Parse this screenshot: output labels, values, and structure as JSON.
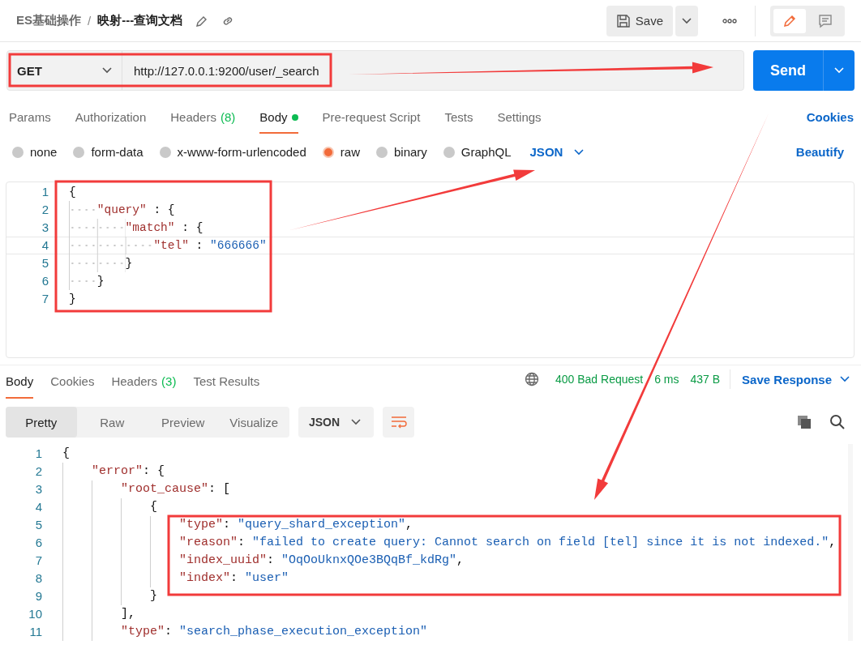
{
  "breadcrumb": {
    "collection": "ES基础操作",
    "separator": "/",
    "request": "映射---查询文档"
  },
  "save_button": "Save",
  "mode_toggle": [
    {
      "kind": "edit",
      "selected": true
    },
    {
      "kind": "comment",
      "selected": false
    }
  ],
  "request": {
    "method": "GET",
    "url": "http://127.0.0.1:9200/user/_search",
    "send": "Send"
  },
  "request_tabs": [
    {
      "label": "Params",
      "selected": false
    },
    {
      "label": "Authorization",
      "selected": false
    },
    {
      "label": "Headers",
      "count": "(8)",
      "selected": false
    },
    {
      "label": "Body",
      "has_content": true,
      "selected": true
    },
    {
      "label": "Pre-request Script",
      "selected": false
    },
    {
      "label": "Tests",
      "selected": false
    },
    {
      "label": "Settings",
      "selected": false
    }
  ],
  "cookies_link": "Cookies",
  "body_types": [
    {
      "label": "none",
      "selected": false
    },
    {
      "label": "form-data",
      "selected": false
    },
    {
      "label": "x-www-form-urlencoded",
      "selected": false
    },
    {
      "label": "raw",
      "selected": true
    },
    {
      "label": "binary",
      "selected": false
    },
    {
      "label": "GraphQL",
      "selected": false
    }
  ],
  "body_format": "JSON",
  "beautify_link": "Beautify",
  "request_body": [
    {
      "number": "1",
      "text": "{",
      "active": false
    },
    {
      "number": "2",
      "text": "    \"query\" : {",
      "active": false
    },
    {
      "number": "3",
      "text": "        \"match\" : {",
      "active": false
    },
    {
      "number": "4",
      "text": "            \"tel\" : \"666666\"",
      "active": true
    },
    {
      "number": "5",
      "text": "        }",
      "active": false
    },
    {
      "number": "6",
      "text": "    }",
      "active": false
    },
    {
      "number": "7",
      "text": "}",
      "active": false
    }
  ],
  "response_tabs": [
    {
      "label": "Body",
      "selected": true
    },
    {
      "label": "Cookies",
      "selected": false
    },
    {
      "label": "Headers",
      "count": "(3)",
      "selected": false
    },
    {
      "label": "Test Results",
      "selected": false
    }
  ],
  "status": {
    "code": "400 Bad Request",
    "time": "6 ms",
    "size": "437 B"
  },
  "save_response": "Save Response",
  "view_modes": [
    {
      "label": "Pretty",
      "selected": true
    },
    {
      "label": "Raw",
      "selected": false
    },
    {
      "label": "Preview",
      "selected": false
    },
    {
      "label": "Visualize",
      "selected": false
    }
  ],
  "response_format": "JSON",
  "response_body": [
    {
      "number": "1",
      "text": "{"
    },
    {
      "number": "2",
      "text": "    \"error\": {"
    },
    {
      "number": "3",
      "text": "        \"root_cause\": ["
    },
    {
      "number": "4",
      "text": "            {"
    },
    {
      "number": "5",
      "text": "                \"type\": \"query_shard_exception\","
    },
    {
      "number": "6",
      "text": "                \"reason\": \"failed to create query: Cannot search on field [tel] since it is not indexed.\","
    },
    {
      "number": "7",
      "text": "                \"index_uuid\": \"OqOoUknxQOe3BQqBf_kdRg\","
    },
    {
      "number": "8",
      "text": "                \"index\": \"user\""
    },
    {
      "number": "9",
      "text": "            }"
    },
    {
      "number": "10",
      "text": "        ],"
    },
    {
      "number": "11",
      "text": "        \"type\": \"search_phase_execution_exception\""
    }
  ]
}
